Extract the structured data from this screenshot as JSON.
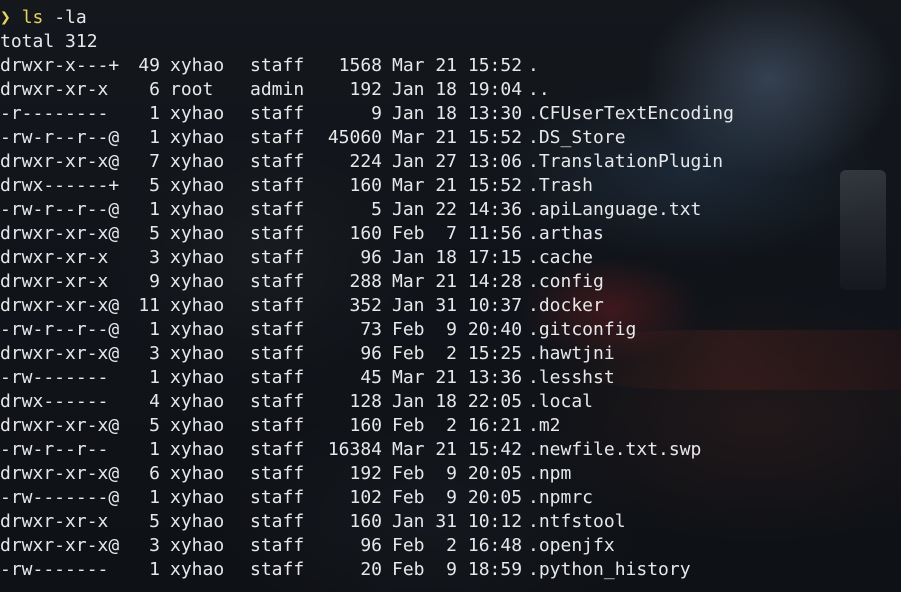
{
  "prompt": {
    "symbol": "❯",
    "command": "ls",
    "args": "-la"
  },
  "summary": "total 312",
  "rows": [
    {
      "perms": "drwxr-x---+",
      "links": "49",
      "owner": "xyhao",
      "group": "staff",
      "size": "1568",
      "date": "Mar 21 15:52",
      "name": "."
    },
    {
      "perms": "drwxr-xr-x",
      "links": "6",
      "owner": "root",
      "group": "admin",
      "size": "192",
      "date": "Jan 18 19:04",
      "name": ".."
    },
    {
      "perms": "-r--------",
      "links": "1",
      "owner": "xyhao",
      "group": "staff",
      "size": "9",
      "date": "Jan 18 13:30",
      "name": ".CFUserTextEncoding"
    },
    {
      "perms": "-rw-r--r--@",
      "links": "1",
      "owner": "xyhao",
      "group": "staff",
      "size": "45060",
      "date": "Mar 21 15:52",
      "name": ".DS_Store"
    },
    {
      "perms": "drwxr-xr-x@",
      "links": "7",
      "owner": "xyhao",
      "group": "staff",
      "size": "224",
      "date": "Jan 27 13:06",
      "name": ".TranslationPlugin"
    },
    {
      "perms": "drwx------+",
      "links": "5",
      "owner": "xyhao",
      "group": "staff",
      "size": "160",
      "date": "Mar 21 15:52",
      "name": ".Trash"
    },
    {
      "perms": "-rw-r--r--@",
      "links": "1",
      "owner": "xyhao",
      "group": "staff",
      "size": "5",
      "date": "Jan 22 14:36",
      "name": ".apiLanguage.txt"
    },
    {
      "perms": "drwxr-xr-x@",
      "links": "5",
      "owner": "xyhao",
      "group": "staff",
      "size": "160",
      "date": "Feb  7 11:56",
      "name": ".arthas"
    },
    {
      "perms": "drwxr-xr-x",
      "links": "3",
      "owner": "xyhao",
      "group": "staff",
      "size": "96",
      "date": "Jan 18 17:15",
      "name": ".cache"
    },
    {
      "perms": "drwxr-xr-x",
      "links": "9",
      "owner": "xyhao",
      "group": "staff",
      "size": "288",
      "date": "Mar 21 14:28",
      "name": ".config"
    },
    {
      "perms": "drwxr-xr-x@",
      "links": "11",
      "owner": "xyhao",
      "group": "staff",
      "size": "352",
      "date": "Jan 31 10:37",
      "name": ".docker"
    },
    {
      "perms": "-rw-r--r--@",
      "links": "1",
      "owner": "xyhao",
      "group": "staff",
      "size": "73",
      "date": "Feb  9 20:40",
      "name": ".gitconfig"
    },
    {
      "perms": "drwxr-xr-x@",
      "links": "3",
      "owner": "xyhao",
      "group": "staff",
      "size": "96",
      "date": "Feb  2 15:25",
      "name": ".hawtjni"
    },
    {
      "perms": "-rw-------",
      "links": "1",
      "owner": "xyhao",
      "group": "staff",
      "size": "45",
      "date": "Mar 21 13:36",
      "name": ".lesshst"
    },
    {
      "perms": "drwx------",
      "links": "4",
      "owner": "xyhao",
      "group": "staff",
      "size": "128",
      "date": "Jan 18 22:05",
      "name": ".local"
    },
    {
      "perms": "drwxr-xr-x@",
      "links": "5",
      "owner": "xyhao",
      "group": "staff",
      "size": "160",
      "date": "Feb  2 16:21",
      "name": ".m2"
    },
    {
      "perms": "-rw-r--r--",
      "links": "1",
      "owner": "xyhao",
      "group": "staff",
      "size": "16384",
      "date": "Mar 21 15:42",
      "name": ".newfile.txt.swp"
    },
    {
      "perms": "drwxr-xr-x@",
      "links": "6",
      "owner": "xyhao",
      "group": "staff",
      "size": "192",
      "date": "Feb  9 20:05",
      "name": ".npm"
    },
    {
      "perms": "-rw-------@",
      "links": "1",
      "owner": "xyhao",
      "group": "staff",
      "size": "102",
      "date": "Feb  9 20:05",
      "name": ".npmrc"
    },
    {
      "perms": "drwxr-xr-x",
      "links": "5",
      "owner": "xyhao",
      "group": "staff",
      "size": "160",
      "date": "Jan 31 10:12",
      "name": ".ntfstool"
    },
    {
      "perms": "drwxr-xr-x@",
      "links": "3",
      "owner": "xyhao",
      "group": "staff",
      "size": "96",
      "date": "Feb  2 16:48",
      "name": ".openjfx"
    },
    {
      "perms": "-rw-------",
      "links": "1",
      "owner": "xyhao",
      "group": "staff",
      "size": "20",
      "date": "Feb  9 18:59",
      "name": ".python_history"
    }
  ],
  "colors": {
    "prompt": "#e3d45d",
    "text": "#e6e8ea",
    "background": "#12161a"
  }
}
